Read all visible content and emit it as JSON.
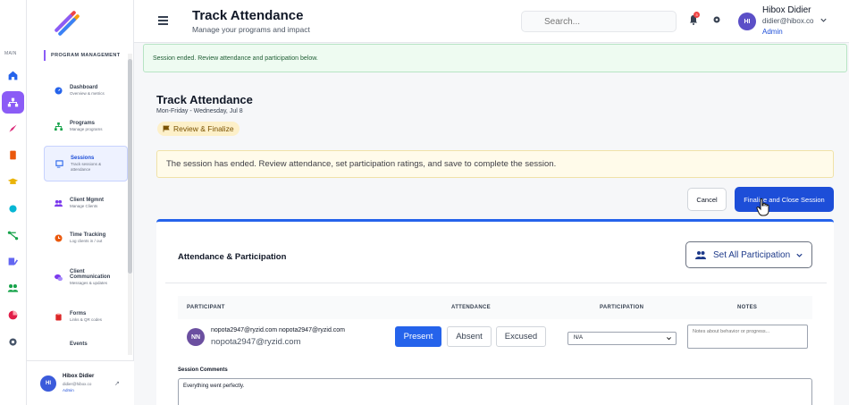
{
  "rail": {
    "main_label": "MAIN"
  },
  "nav": {
    "section_title": "PROGRAM MANAGEMENT",
    "items": [
      {
        "title": "Dashboard",
        "sub": "Overview & metrics",
        "icon": "dashboard-icon",
        "color": "#2563eb"
      },
      {
        "title": "Programs",
        "sub": "Manage programs",
        "icon": "sitemap-icon",
        "color": "#16a34a"
      },
      {
        "title": "Sessions",
        "sub": "Track sessions & attendance",
        "icon": "chalkboard-icon",
        "color": "#2563eb"
      },
      {
        "title": "Client Mgmnt",
        "sub": "Manage Clients",
        "icon": "users-icon",
        "color": "#7c3aed"
      },
      {
        "title": "Time Tracking",
        "sub": "Log clients in / out",
        "icon": "clock-icon",
        "color": "#ea580c"
      },
      {
        "title": "Client Communication",
        "sub": "Messages & updates",
        "icon": "comments-icon",
        "color": "#7c3aed"
      },
      {
        "title": "Forms",
        "sub": "Links & QR codes",
        "icon": "clipboard-icon",
        "color": "#dc2626"
      },
      {
        "title": "Events",
        "sub": "",
        "icon": "calendar-icon",
        "color": "#2563eb"
      }
    ],
    "footer": {
      "initials": "HI",
      "name": "Hibox Didier",
      "email": "didier@hibox.co",
      "role": "Admin"
    }
  },
  "header": {
    "title": "Track Attendance",
    "subtitle": "Manage your programs and impact",
    "search_placeholder": "Search...",
    "notification_count": "3",
    "user": {
      "initials": "HI",
      "name": "Hibox Didier",
      "email": "didier@hibox.co",
      "role": "Admin"
    }
  },
  "banner": {
    "text": "Session ended. Review attendance and participation below."
  },
  "page": {
    "title": "Track Attendance",
    "date": "Mon-Friday - Wednesday, Jul 8",
    "status_pill": "Review & Finalize",
    "notice": "The session has ended. Review attendance, set participation ratings, and save to complete the session."
  },
  "actions": {
    "cancel": "Cancel",
    "finalize": "Finalize and Close Session"
  },
  "card": {
    "title": "Attendance & Participation",
    "set_all": "Set All Participation",
    "columns": [
      "PARTICIPANT",
      "ATTENDANCE",
      "PARTICIPATION",
      "NOTES"
    ],
    "rows": [
      {
        "initials": "NN",
        "name_line": "nopota2947@ryzid.com nopota2947@ryzid.com",
        "email": "nopota2947@ryzid.com",
        "attendance_options": [
          "Present",
          "Absent",
          "Excused"
        ],
        "participation": "N/A",
        "notes_placeholder": "Notes about behavior or progress..."
      }
    ],
    "session_comments_label": "Session Comments",
    "session_comments": "Everything went perfectly."
  },
  "colors": {
    "accent": "#1d4ed8",
    "primary_button": "#2563eb",
    "rail_active": "#8b5cf6"
  }
}
